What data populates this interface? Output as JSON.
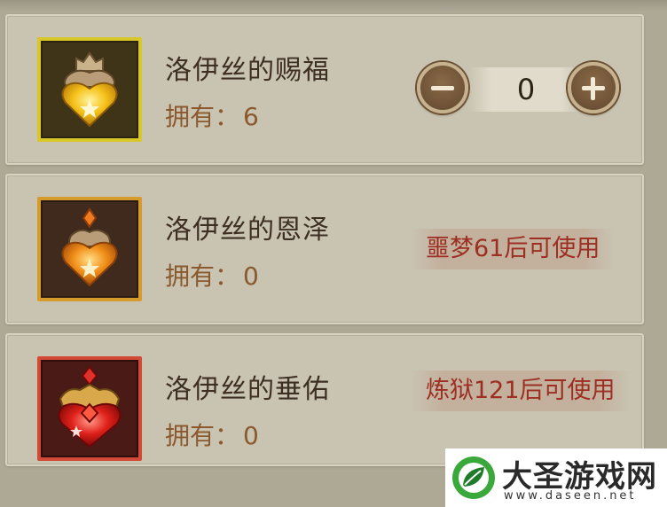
{
  "items": [
    {
      "name": "洛伊丝的赐福",
      "owned_label": "拥有：",
      "owned_count": "6",
      "icon": "yellow-heart-gem-icon",
      "frame_color": "#d9c629",
      "quantity": "0"
    },
    {
      "name": "洛伊丝的恩泽",
      "owned_label": "拥有：",
      "owned_count": "0",
      "icon": "orange-heart-gem-icon",
      "frame_color": "#d79b2c",
      "unlock_note": "噩梦61后可使用"
    },
    {
      "name": "洛伊丝的垂佑",
      "owned_label": "拥有：",
      "owned_count": "0",
      "icon": "red-heart-gem-icon",
      "frame_color": "#d24a36",
      "unlock_note": "炼狱121后可使用"
    }
  ],
  "watermark": {
    "title": "大圣游戏网",
    "url": "www.daseen.net",
    "logo_icon": "leaf-circle-logo-icon"
  },
  "colors": {
    "background": "#aea995",
    "panel": "#c9c3b1",
    "name_text": "#3d2f22",
    "owned_text": "#8a5a2e",
    "unlock_text": "#9c2f22"
  }
}
